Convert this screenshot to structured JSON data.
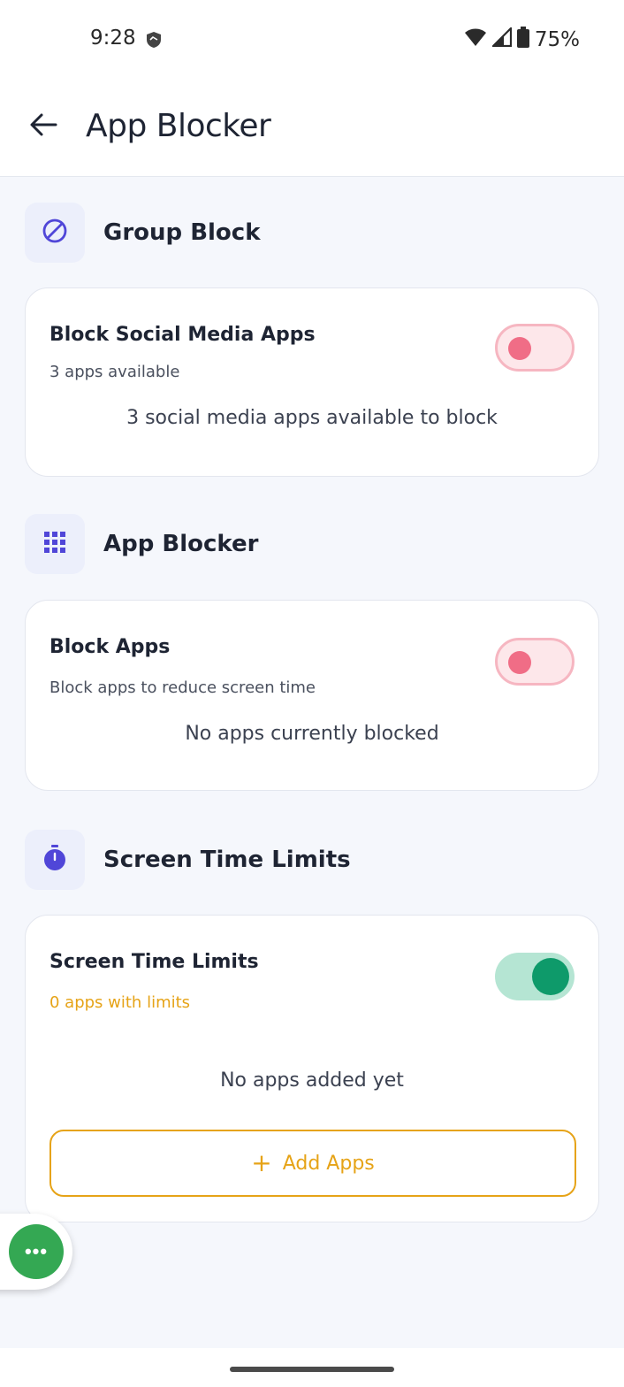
{
  "status_bar": {
    "time": "9:28",
    "battery": "75%"
  },
  "app_bar": {
    "title": "App Blocker",
    "back_icon": "arrow-left-icon"
  },
  "sections": {
    "group_block": {
      "title": "Group Block",
      "icon": "block-icon",
      "card": {
        "title": "Block Social Media Apps",
        "subtitle": "3 apps available",
        "message": "3 social media apps available to block",
        "toggle_on": false
      }
    },
    "app_blocker": {
      "title": "App Blocker",
      "icon": "grid-icon",
      "card": {
        "title": "Block Apps",
        "subtitle": "Block apps to reduce screen time",
        "message": "No apps currently blocked",
        "toggle_on": false
      }
    },
    "screen_time": {
      "title": "Screen Time Limits",
      "icon": "stopwatch-icon",
      "card": {
        "title": "Screen Time Limits",
        "subtitle": "0 apps with limits",
        "message": "No apps added yet",
        "toggle_on": true,
        "add_button": {
          "icon": "+",
          "label": "Add Apps"
        }
      }
    }
  },
  "fab": {
    "icon": "more-horizontal-icon",
    "label": "•••"
  },
  "colors": {
    "accent": "#5046d8",
    "toggle_off": "#f06d86",
    "toggle_on": "#0e9a6a",
    "warning": "#e6a317",
    "fab": "#34a853"
  }
}
